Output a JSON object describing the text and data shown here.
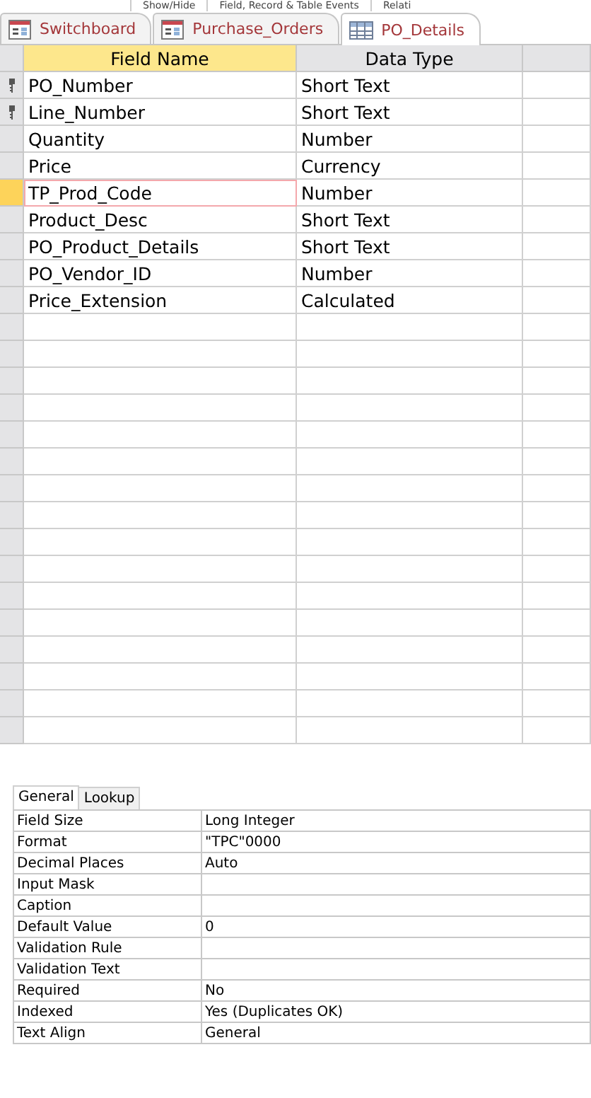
{
  "ribbon_groups": [
    "Show/Hide",
    "Field, Record & Table Events",
    "Relati"
  ],
  "tabs": [
    {
      "label": "Switchboard",
      "kind": "form",
      "selected": false
    },
    {
      "label": "Purchase_Orders",
      "kind": "form",
      "selected": false
    },
    {
      "label": "PO_Details",
      "kind": "table",
      "selected": true
    }
  ],
  "table": {
    "columns": [
      "Field Name",
      "Data Type"
    ],
    "rows": [
      {
        "field_name": "PO_Number",
        "data_type": "Short Text",
        "primary_key": true,
        "selected": false
      },
      {
        "field_name": "Line_Number",
        "data_type": "Short Text",
        "primary_key": true,
        "selected": false
      },
      {
        "field_name": "Quantity",
        "data_type": "Number",
        "primary_key": false,
        "selected": false
      },
      {
        "field_name": "Price",
        "data_type": "Currency",
        "primary_key": false,
        "selected": false
      },
      {
        "field_name": "TP_Prod_Code",
        "data_type": "Number",
        "primary_key": false,
        "selected": true
      },
      {
        "field_name": "Product_Desc",
        "data_type": "Short Text",
        "primary_key": false,
        "selected": false
      },
      {
        "field_name": "PO_Product_Details",
        "data_type": "Short Text",
        "primary_key": false,
        "selected": false
      },
      {
        "field_name": "PO_Vendor_ID",
        "data_type": "Number",
        "primary_key": false,
        "selected": false
      },
      {
        "field_name": "Price_Extension",
        "data_type": "Calculated",
        "primary_key": false,
        "selected": false
      }
    ]
  },
  "field_properties": {
    "tabs": [
      {
        "label": "General",
        "selected": true
      },
      {
        "label": "Lookup",
        "selected": false
      }
    ],
    "rows": [
      {
        "name": "Field Size",
        "value": "Long Integer"
      },
      {
        "name": "Format",
        "value": "\"TPC\"0000"
      },
      {
        "name": "Decimal Places",
        "value": "Auto"
      },
      {
        "name": "Input Mask"
      },
      {
        "name": "Caption"
      },
      {
        "name": "Default Value",
        "value": "0"
      },
      {
        "name": "Validation Rule"
      },
      {
        "name": "Validation Text"
      },
      {
        "name": "Required",
        "value": "No"
      },
      {
        "name": "Indexed",
        "value": "Yes (Duplicates OK)"
      },
      {
        "name": "Text Align",
        "value": "General"
      }
    ]
  }
}
